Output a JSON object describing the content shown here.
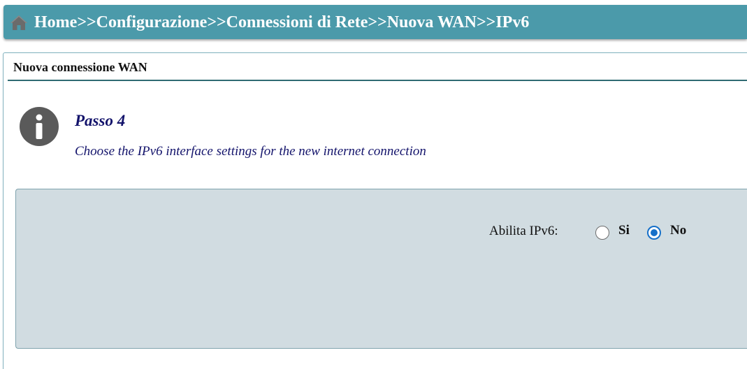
{
  "breadcrumb": {
    "text": "Home>>Configurazione>>Connessioni di Rete>>Nuova WAN>>IPv6",
    "icon": "home-icon"
  },
  "panel": {
    "title": "Nuova connessione WAN",
    "step": {
      "icon": "info-icon",
      "title": "Passo 4",
      "description": "Choose the IPv6 interface settings for the new internet connection"
    }
  },
  "settings": {
    "enable_ipv6": {
      "label": "Abilita IPv6:",
      "options": [
        {
          "label": "Si",
          "selected": false
        },
        {
          "label": "No",
          "selected": true
        }
      ]
    }
  },
  "colors": {
    "header_bar": "#4b9aaa",
    "settings_box": "#d1dce1",
    "step_text": "#13136b",
    "radio_accent": "#1670c9"
  }
}
